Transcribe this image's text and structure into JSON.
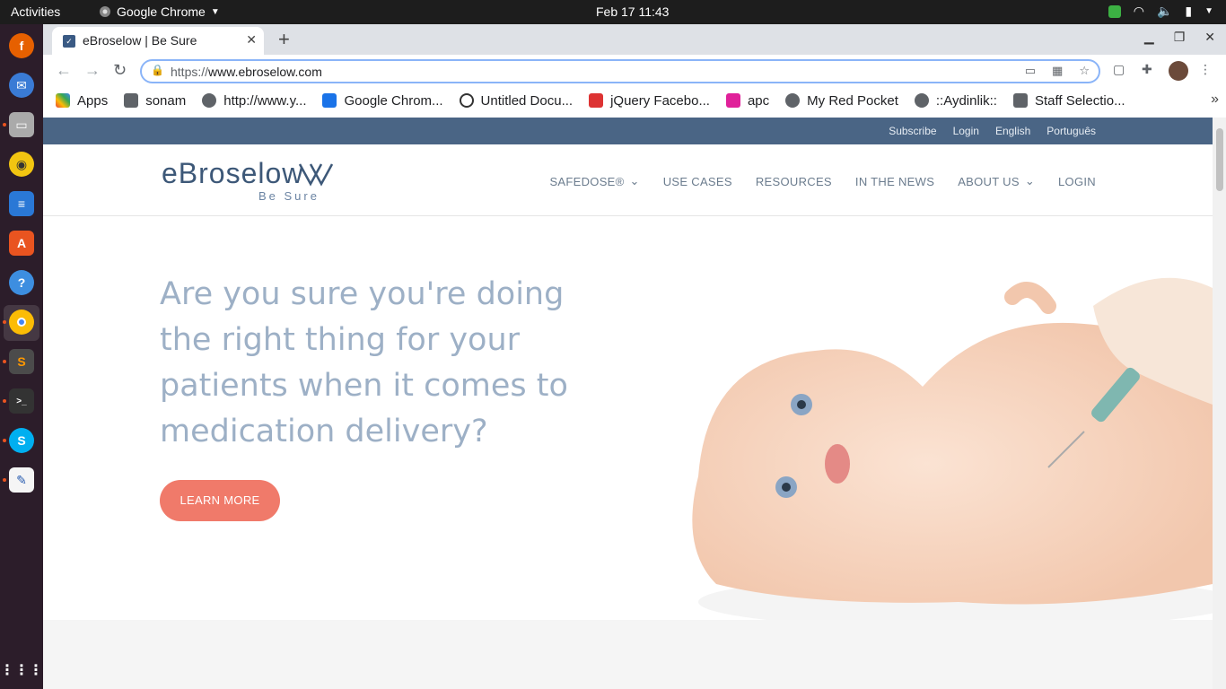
{
  "topbar": {
    "activities": "Activities",
    "app_name": "Google Chrome",
    "clock": "Feb 17  11:43"
  },
  "tab": {
    "title": "eBroselow | Be Sure",
    "close_glyph": "✕",
    "new_tab_glyph": "+"
  },
  "omnibox": {
    "scheme": "https://",
    "host": "www.ebroselow.com"
  },
  "bookmarks": [
    {
      "label": "Apps",
      "icon": "apps-grid-icon",
      "color": "#4285f4"
    },
    {
      "label": "sonam",
      "icon": "folder-icon",
      "color": "#5f6368"
    },
    {
      "label": "http://www.y...",
      "icon": "globe-icon",
      "color": "#5f6368"
    },
    {
      "label": "Google Chrom...",
      "icon": "grid-icon",
      "color": "#1a73e8"
    },
    {
      "label": "Untitled Docu...",
      "icon": "doc-icon",
      "color": "#333333"
    },
    {
      "label": "jQuery Facebo...",
      "icon": "jquery-icon",
      "color": "#d33"
    },
    {
      "label": "apc",
      "icon": "apc-icon",
      "color": "#e0219a"
    },
    {
      "label": "My Red Pocket",
      "icon": "globe-icon",
      "color": "#5f6368"
    },
    {
      "label": "::Aydinlik::",
      "icon": "globe-icon",
      "color": "#5f6368"
    },
    {
      "label": "Staff Selectio...",
      "icon": "staff-icon",
      "color": "#5f6368"
    }
  ],
  "site": {
    "top_links": [
      "Subscribe",
      "Login",
      "English",
      "Português"
    ],
    "logo_brand": "eBroselow",
    "logo_tag": "Be Sure",
    "nav": [
      {
        "label": "SAFEDOSE®",
        "has_dropdown": true
      },
      {
        "label": "USE CASES",
        "has_dropdown": false
      },
      {
        "label": "RESOURCES",
        "has_dropdown": false
      },
      {
        "label": "IN THE NEWS",
        "has_dropdown": false
      },
      {
        "label": "ABOUT US",
        "has_dropdown": true
      },
      {
        "label": "LOGIN",
        "has_dropdown": false
      }
    ],
    "hero_heading": "Are you sure you're doing the right thing for your patients when it comes to medication delivery?",
    "hero_button": "LEARN MORE",
    "colors": {
      "topbar": "#4a6585",
      "brand": "#3d5878",
      "hero_text": "#9db0c6",
      "button": "#f07a6a"
    }
  }
}
